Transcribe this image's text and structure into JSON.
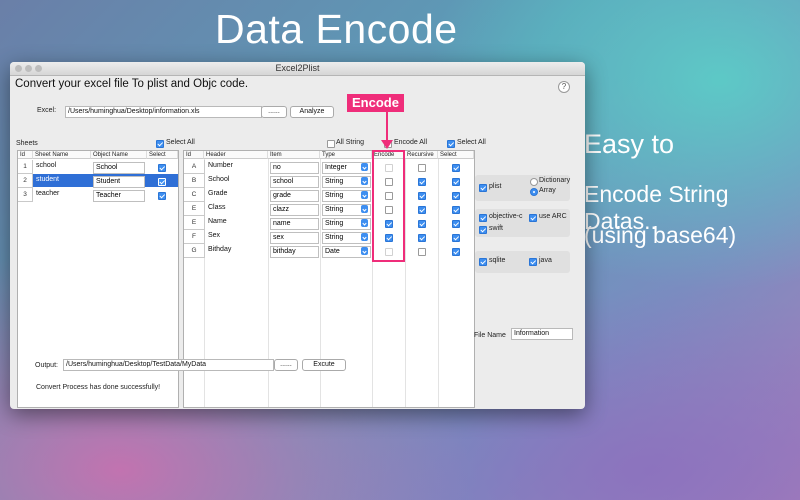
{
  "hero_title": "Data Encode",
  "side_text": [
    "Easy to",
    "Encode String Datas..",
    "(using base64)"
  ],
  "window": {
    "title": "Excel2Plist",
    "heading": "Convert your excel file To plist and Objc code.",
    "help": "?"
  },
  "excel": {
    "label": "Excel:",
    "path": "/Users/huminghua/Desktop/information.xls",
    "browse": "......",
    "button": "Analyze"
  },
  "sheets": {
    "label": "Sheets",
    "select_all_label": "Select All",
    "select_all": true,
    "columns": [
      "Id",
      "Sheet Name",
      "Object Name",
      "Select"
    ],
    "rows": [
      {
        "id": "1",
        "sheet": "school",
        "object": "School",
        "selected": true
      },
      {
        "id": "2",
        "sheet": "student",
        "object": "Student",
        "selected": true,
        "highlighted": true
      },
      {
        "id": "3",
        "sheet": "teacher",
        "object": "Teacher",
        "selected": true
      }
    ]
  },
  "headers": {
    "all_string_label": "All String",
    "all_string": false,
    "encode_all_label": "Encode All",
    "encode_all": false,
    "select_all_label": "Select All",
    "select_all": true,
    "columns": [
      "Id",
      "Header",
      "Item",
      "Type",
      "Encode",
      "Recursive",
      "Select"
    ],
    "rows": [
      {
        "id": "A",
        "header": "Number",
        "item": "no",
        "type": "Integer",
        "encode": false,
        "encode_disabled": true,
        "recursive": false,
        "select": true
      },
      {
        "id": "B",
        "header": "School",
        "item": "school",
        "type": "String",
        "encode": false,
        "recursive": true,
        "select": true
      },
      {
        "id": "C",
        "header": "Grade",
        "item": "grade",
        "type": "String",
        "encode": false,
        "recursive": true,
        "select": true
      },
      {
        "id": "E",
        "header": "Class",
        "item": "clazz",
        "type": "String",
        "encode": false,
        "recursive": true,
        "select": true
      },
      {
        "id": "E",
        "header": "Name",
        "item": "name",
        "type": "String",
        "encode": true,
        "recursive": true,
        "select": true
      },
      {
        "id": "F",
        "header": "Sex",
        "item": "sex",
        "type": "String",
        "encode": true,
        "recursive": true,
        "select": true
      },
      {
        "id": "G",
        "header": "Bithday",
        "item": "bithday",
        "type": "Date",
        "encode": false,
        "encode_disabled": true,
        "recursive": false,
        "select": true
      }
    ]
  },
  "options": {
    "plist_label": "plist",
    "plist": true,
    "dictionary_label": "Dictionary",
    "dictionary": false,
    "array_label": "Array",
    "array": true,
    "objc_label": "objective-c",
    "objc": true,
    "arc_label": "use ARC",
    "arc": true,
    "swift_label": "swift",
    "swift": true,
    "sqlite_label": "sqlite",
    "sqlite": true,
    "java_label": "java",
    "java": true
  },
  "file_name": {
    "label": "File Name",
    "value": "Information"
  },
  "output": {
    "label": "Output:",
    "path": "/Users/huminghua/Desktop/TestData/MyData",
    "browse": "......",
    "button": "Excute"
  },
  "status": "Convert Process has done successfully!",
  "annotation": {
    "label": "Encode"
  },
  "colors": {
    "accent": "#3d8ef0",
    "annotation": "#ef2d7a",
    "selection": "#2f6fd6"
  }
}
